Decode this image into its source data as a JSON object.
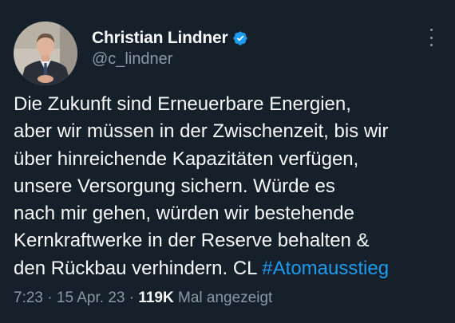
{
  "author": {
    "display_name": "Christian Lindner",
    "handle": "@c_lindner",
    "verified": true,
    "avatar": "profile-photo"
  },
  "tweet": {
    "lines": [
      "Die Zukunft sind Erneuerbare Energien,",
      "aber wir müssen in der Zwischenzeit, bis wir",
      "über hinreichende Kapazitäten verfügen,",
      "unsere Versorgung sichern. Würde es",
      "nach mir gehen, würden wir bestehende",
      "Kernkraftwerke in der Reserve behalten &"
    ],
    "last_line_text": "den Rückbau verhindern. CL ",
    "hashtag": "#Atomausstieg"
  },
  "meta": {
    "time": "7:23",
    "separator": " · ",
    "date": "15 Apr. 23",
    "views_count": "119K",
    "views_label": " Mal angezeigt"
  },
  "colors": {
    "background": "#15202b",
    "primary_text": "#f7f9f9",
    "secondary_text": "#8b98a5",
    "accent": "#1d9bf0"
  },
  "icons": {
    "verified": "verified-badge-icon",
    "more": "more-options-icon"
  }
}
